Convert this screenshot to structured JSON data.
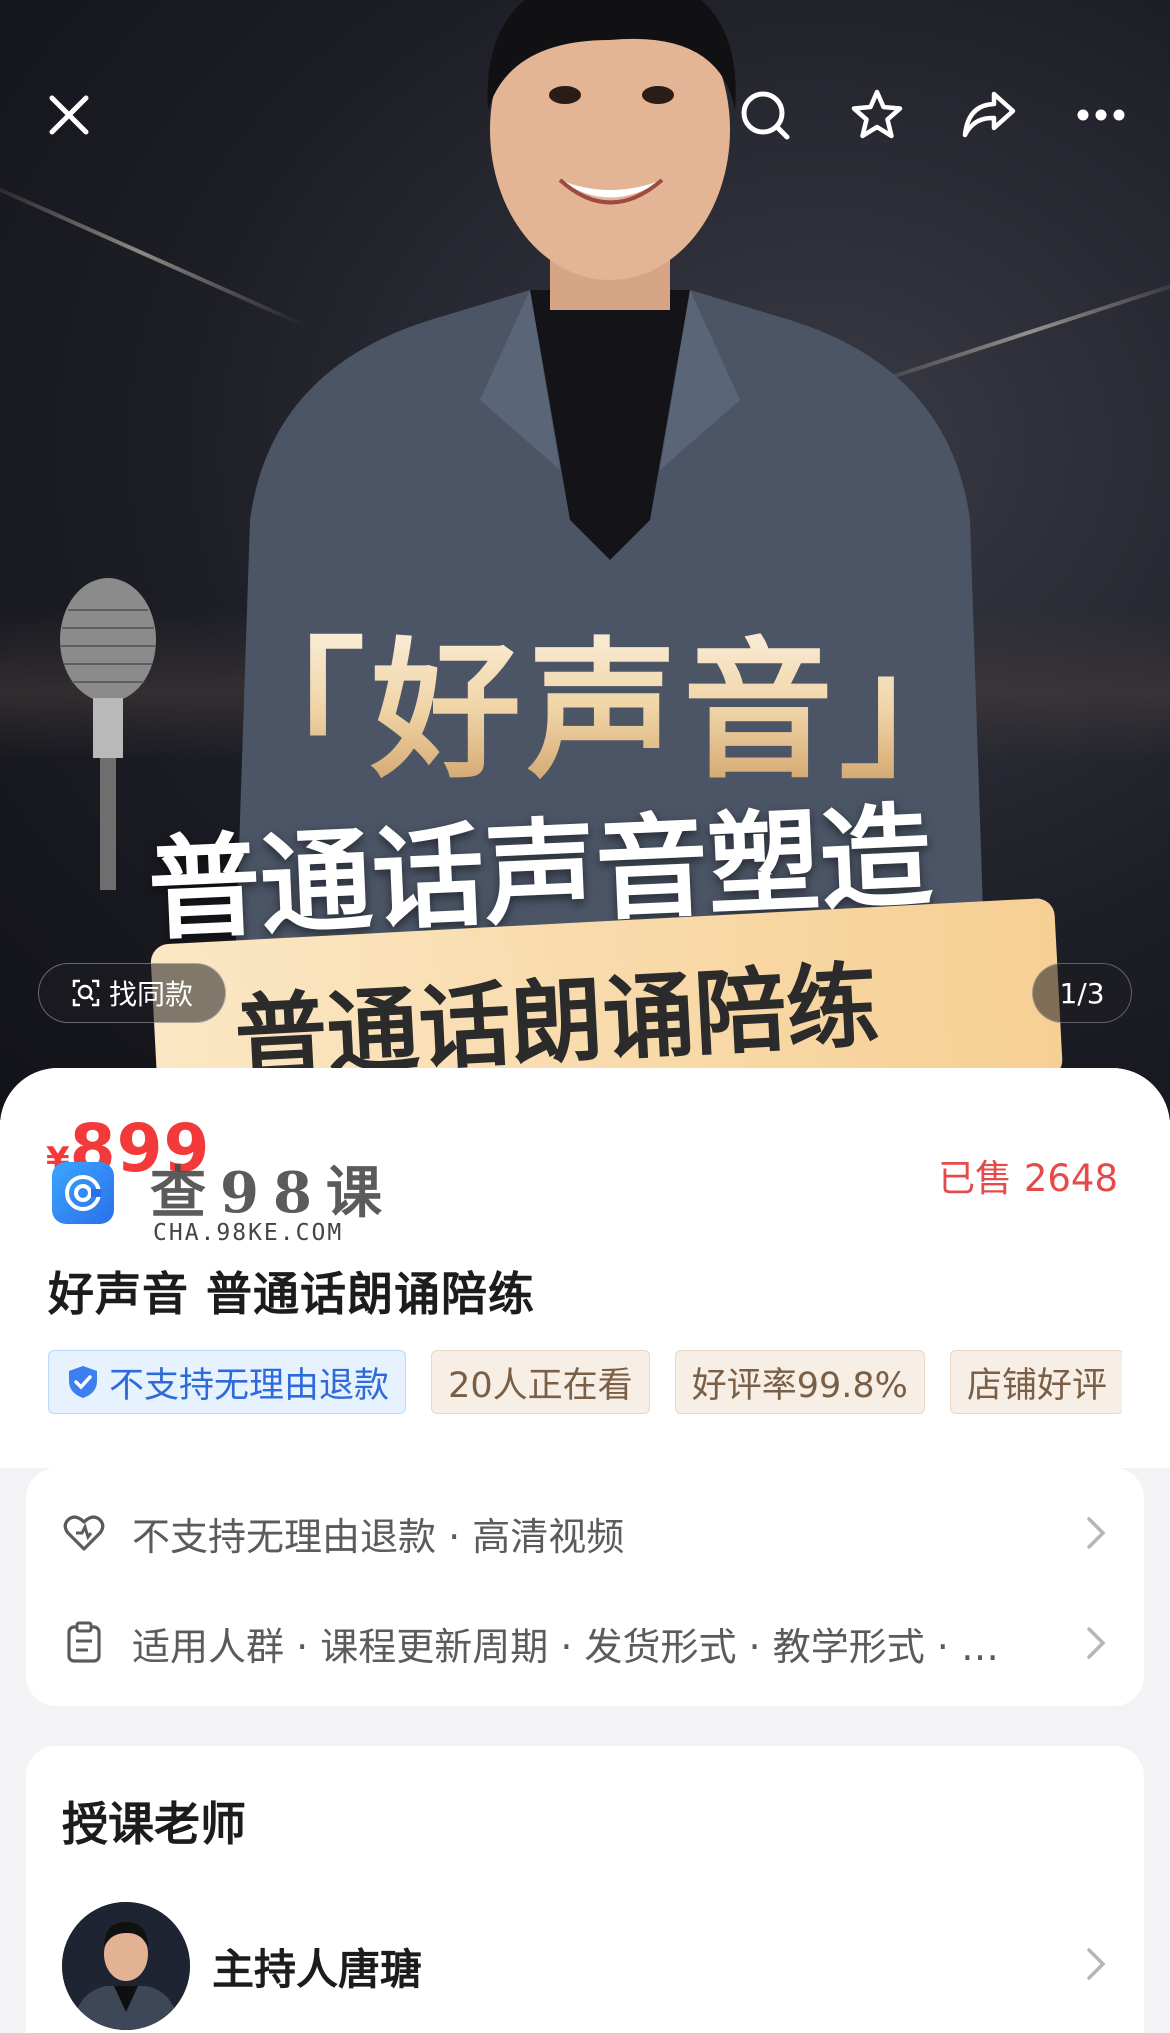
{
  "hero": {
    "title_big": "「好声音」",
    "title_sub": "普通话声音塑造",
    "title_badge": "普通话朗诵陪练",
    "find_same_label": "找同款",
    "page_counter": "1/3",
    "icons": [
      "close-icon",
      "search-icon",
      "star-icon",
      "share-icon",
      "more-icon"
    ]
  },
  "product": {
    "currency": "¥",
    "price": "899",
    "sold": "已售 2648",
    "title": "好声音 普通话朗诵陪练",
    "tags": [
      "不支持无理由退款",
      "20人正在看",
      "好评率99.8%",
      "店铺好评"
    ]
  },
  "watermark": {
    "text": "查98课",
    "url": "CHA.98KE.COM"
  },
  "info": {
    "row1": "不支持无理由退款 · 高清视频",
    "row2": "适用人群 · 课程更新周期 · 发货形式 · 教学形式 · …"
  },
  "teacher": {
    "section_title": "授课老师",
    "name": "主持人唐瑭"
  },
  "colors": {
    "price_red": "#f23a3a",
    "tag_blue": "#2f6bd8",
    "tag_beige_text": "#7a5e45",
    "badge_gold": "#f6cf93"
  }
}
